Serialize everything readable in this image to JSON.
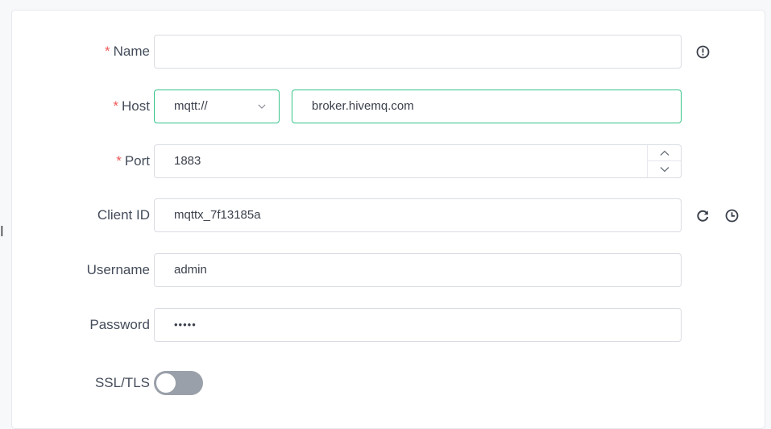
{
  "edge_text": "l",
  "form": {
    "name": {
      "label": "Name",
      "required_mark": "*",
      "value": "",
      "info_icon": "info-circle-icon"
    },
    "host": {
      "label": "Host",
      "required_mark": "*",
      "protocol_value": "mqtt://",
      "value": "broker.hivemq.com"
    },
    "port": {
      "label": "Port",
      "required_mark": "*",
      "value": "1883"
    },
    "client_id": {
      "label": "Client ID",
      "value": "mqttx_7f13185a",
      "refresh_icon": "refresh-icon",
      "clock_icon": "clock-icon"
    },
    "username": {
      "label": "Username",
      "value": "admin"
    },
    "password": {
      "label": "Password",
      "value": "•••••"
    },
    "ssl_tls": {
      "label": "SSL/TLS",
      "enabled": false
    }
  },
  "colors": {
    "accent": "#34c388",
    "required": "#ee5a5a",
    "switch_off": "#9aa0a9",
    "border": "#d9dce3"
  }
}
